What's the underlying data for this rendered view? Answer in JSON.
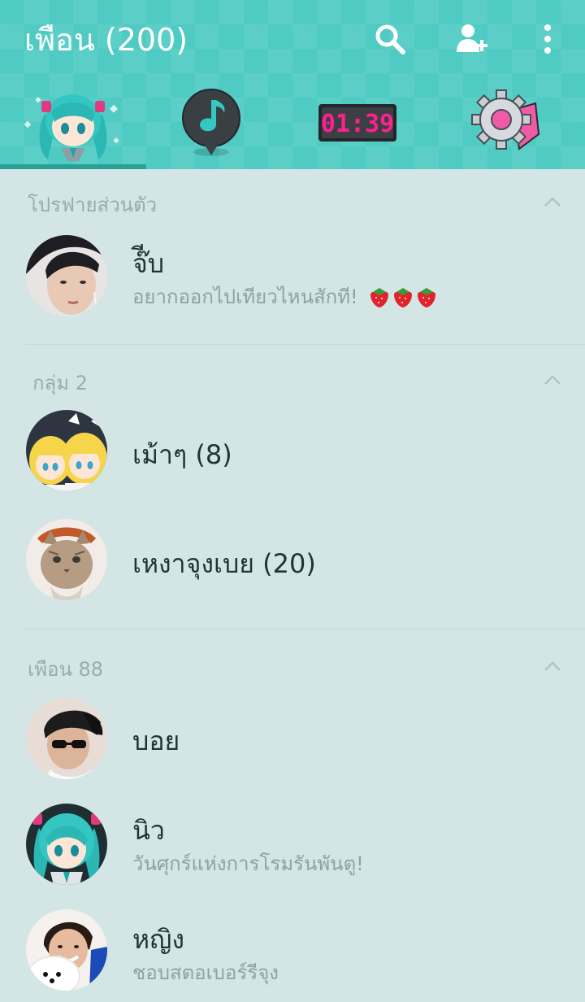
{
  "header": {
    "title": "เพือน (200)",
    "clock": "01:39"
  },
  "sections": {
    "profile": {
      "label": "โปรฟายส่วนตัว"
    },
    "groups": {
      "label": "กลุ่ม 2"
    },
    "friends": {
      "label": "เพือน 88"
    }
  },
  "profile": {
    "name": "จ๊ีบ",
    "status": "อยากออกไปเทียวไหนสักที!"
  },
  "groups": [
    {
      "name": "เม้าๆ (8)"
    },
    {
      "name": "เหงาจุงเบย (20)"
    }
  ],
  "friends": [
    {
      "name": "บอย",
      "status": ""
    },
    {
      "name": "นิว",
      "status": "วันศุกร์แห่งการโรมรันพันตู!"
    },
    {
      "name": "หญิง",
      "status": "ชอบสตอเบอร์รีจุง"
    }
  ],
  "colors": {
    "header": "#4fcbc3",
    "background": "#d3e6e5",
    "tab_underline": "#2a9f98",
    "clock": "#ff1f8e"
  },
  "icons": [
    "search-icon",
    "add-friend-icon",
    "more-icon",
    "music-note-icon",
    "gear-icon",
    "chevron-up-icon"
  ]
}
